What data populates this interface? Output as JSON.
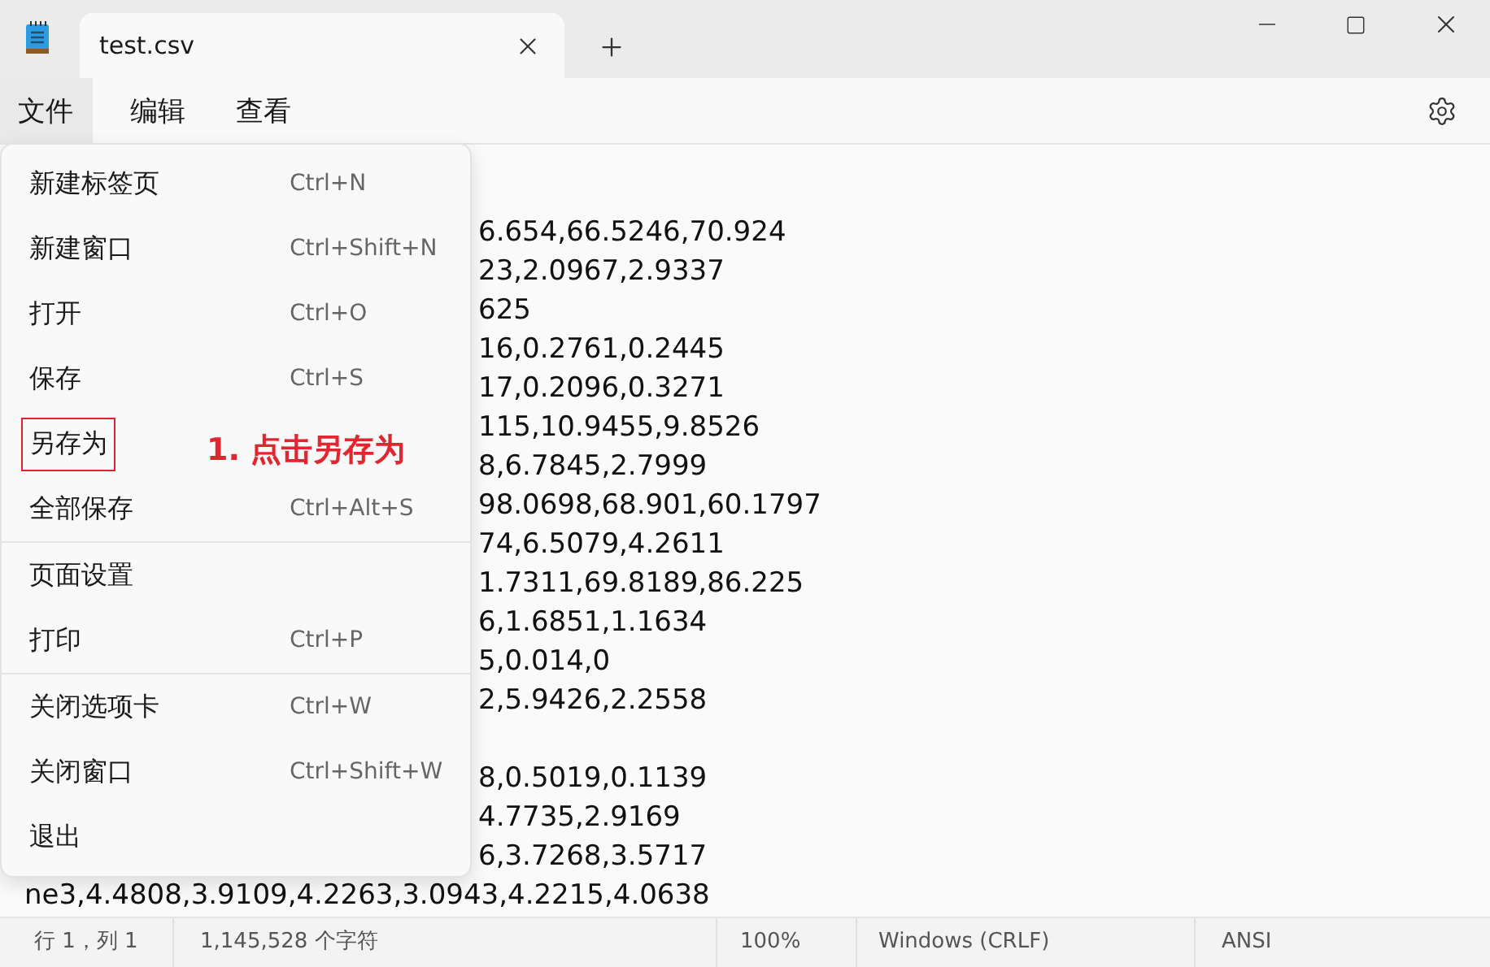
{
  "tabs": [
    {
      "label": "test.csv",
      "selected": true
    }
  ],
  "menu_bar": [
    {
      "label": "文件",
      "selected": true
    },
    {
      "label": "编辑",
      "selected": false
    },
    {
      "label": "查看",
      "selected": false
    }
  ],
  "file_menu": {
    "groups": [
      [
        {
          "label": "新建标签页",
          "shortcut": "Ctrl+N",
          "annotated": false
        },
        {
          "label": "新建窗口",
          "shortcut": "Ctrl+Shift+N",
          "annotated": false
        },
        {
          "label": "打开",
          "shortcut": "Ctrl+O",
          "annotated": false
        },
        {
          "label": "保存",
          "shortcut": "Ctrl+S",
          "annotated": false
        },
        {
          "label": "另存为",
          "annotated": true
        },
        {
          "label": "全部保存",
          "shortcut": "Ctrl+Alt+S",
          "annotated": false
        }
      ],
      [
        {
          "label": "页面设置",
          "annotated": false
        },
        {
          "label": "打印",
          "shortcut": "Ctrl+P",
          "annotated": false
        }
      ],
      [
        {
          "label": "关闭选项卡",
          "shortcut": "Ctrl+W",
          "annotated": false
        },
        {
          "label": "关闭窗口",
          "shortcut": "Ctrl+Shift+W",
          "annotated": false
        },
        {
          "label": "退出",
          "annotated": false
        }
      ]
    ]
  },
  "annotation": "1. 点击另存为",
  "editor": {
    "lines": [
      {
        "kind": "partial"
      },
      {
        "kind": "partial",
        "text": "6.654,66.5246,70.924"
      },
      {
        "kind": "partial",
        "text": "23,2.0967,2.9337"
      },
      {
        "kind": "partial",
        "text": "625"
      },
      {
        "kind": "partial",
        "text": "16,0.2761,0.2445"
      },
      {
        "kind": "partial",
        "text": "17,0.2096,0.3271"
      },
      {
        "kind": "partial",
        "text": "115,10.9455,9.8526"
      },
      {
        "kind": "partial",
        "text": "8,6.7845,2.7999"
      },
      {
        "kind": "partial",
        "text": "98.0698,68.901,60.1797"
      },
      {
        "kind": "partial",
        "text": "74,6.5079,4.2611"
      },
      {
        "kind": "partial",
        "text": "1.7311,69.8189,86.225"
      },
      {
        "kind": "partial",
        "text": "6,1.6851,1.1634"
      },
      {
        "kind": "partial",
        "text": "5,0.014,0"
      },
      {
        "kind": "partial",
        "text": "2,5.9426,2.2558"
      },
      {
        "kind": "partial"
      },
      {
        "kind": "partial",
        "text": "8,0.5019,0.1139"
      },
      {
        "kind": "partial",
        "text": "4.7735,2.9169"
      },
      {
        "kind": "partial",
        "text": "6,3.7268,3.5717"
      },
      {
        "kind": "full",
        "text": "ne3,4.4808,3.9109,4.2263,3.0943,4.2215,4.0638"
      }
    ]
  },
  "status_bar": {
    "position": "行 1，列 1",
    "characters": "1,145,528 个字符",
    "zoom": "100%",
    "line_ending": "Windows (CRLF)",
    "encoding": "ANSI"
  }
}
